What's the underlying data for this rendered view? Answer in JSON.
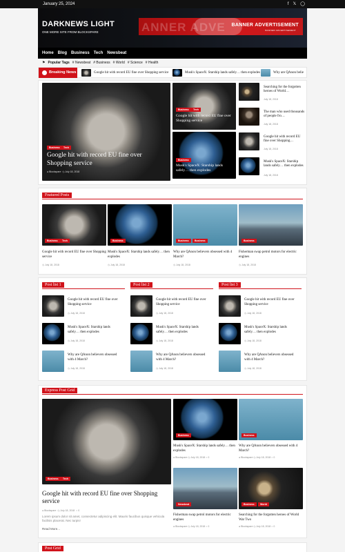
{
  "date": "January 25, 2024",
  "header": {
    "title": "DARKNEWS LIGHT",
    "tagline": "ONE MORE SITE FROM BLOCKSPARE",
    "banner_ghost": "ANNER ADVE",
    "banner_title": "BANNER ADVERTISEMENT",
    "banner_sub": "BANNER ADVERTISEMENT"
  },
  "social": [
    "f-icon",
    "twitter-icon",
    "instagram-icon"
  ],
  "nav": [
    "Home",
    "Blog",
    "Business",
    "Tech",
    "Newsbeat"
  ],
  "popular": {
    "label": "Popular Tags",
    "tags": [
      "Newsbeat",
      "Business",
      "World",
      "Science",
      "Health"
    ]
  },
  "breaking": {
    "label": "Breaking News",
    "items": [
      "Google hit with record EU fine over Shopping service",
      "Musk's SpaceX: Starship lands safely… then explodes",
      "Why are QAnon belie"
    ]
  },
  "hero": {
    "title": "Google hit with record EU fine over Shopping service",
    "badges": [
      "Business",
      "Tech"
    ],
    "author": "Blockspare",
    "date": "July 18, 2018"
  },
  "side_cards": [
    {
      "badges": [
        "Business",
        "Tech"
      ],
      "title": "Google hit with record EU fine over Shopping service"
    },
    {
      "badges": [
        "Business"
      ],
      "title": "Musk's SpaceX: Starship lands safely… then explodes"
    }
  ],
  "side_list": [
    {
      "title": "Searching for the forgotten heroes of World…",
      "date": "July 18, 2018"
    },
    {
      "title": "The man who used thousands of people fro…",
      "date": "July 18, 2018"
    },
    {
      "title": "Google hit with record EU fine over Shopping…",
      "date": "July 18, 2018"
    },
    {
      "title": "Musk's SpaceX: Starship lands safely… then explodes",
      "date": "July 18, 2018"
    }
  ],
  "featured": {
    "title": "Featured Posts",
    "items": [
      {
        "badges": [
          "Business",
          "Tech"
        ],
        "title": "Google hit with record EU fine over Shopping service",
        "date": "July 18, 2018"
      },
      {
        "badges": [
          "Business"
        ],
        "title": "Musk's SpaceX: Starship lands safely… then explodes",
        "date": "July 18, 2018"
      },
      {
        "badges": [
          "Business",
          "Business"
        ],
        "title": "Why are QAnon believers obsessed with 4 March?",
        "date": "July 18, 2018"
      },
      {
        "badges": [
          "Business"
        ],
        "title": "Fisherman swap petrol motors for electric engines",
        "date": "July 18, 2018"
      }
    ]
  },
  "postlists": [
    {
      "title": "Post list 1"
    },
    {
      "title": "Post list 2"
    },
    {
      "title": "Post list 3"
    }
  ],
  "postlist_items": [
    {
      "title": "Google hit with record EU fine over Shopping service",
      "date": "July 18, 2018"
    },
    {
      "title": "Musk's SpaceX: Starship lands safely… then explodes",
      "date": "July 18, 2018"
    },
    {
      "title": "Why are QAnon believers obsessed with 4 March?",
      "date": "July 18, 2018"
    }
  ],
  "express": {
    "title": "Express Post Grid",
    "main": {
      "badges": [
        "Business",
        "Tech"
      ],
      "title": "Google hit with record EU fine over Shopping service",
      "author": "Blockspare",
      "date": "July 18, 2018",
      "comments": "0",
      "excerpt": "Lorem ipsum dolor sit amet, consectetur adipiscing elit. Mauris faucibus quisque vehicula facilisis placerat. Nec turpis!",
      "read_more": "Read More..."
    },
    "grid": [
      {
        "badges": [
          "Business"
        ],
        "title": "Musk's SpaceX: Starship lands safely… then explodes",
        "author": "Blockspare",
        "date": "July 18, 2018",
        "comments": "0"
      },
      {
        "badges": [
          "Business"
        ],
        "title": "Why are QAnon believers obsessed with 4 March?",
        "author": "Blockspare",
        "date": "July 18, 2018",
        "comments": "0"
      },
      {
        "badges": [
          "Newsbeat"
        ],
        "title": "Fisherman swap petrol motors for electric engines",
        "author": "Blockspare",
        "date": "July 18, 2018",
        "comments": "0"
      },
      {
        "badges": [
          "Business",
          "World"
        ],
        "title": "Searching for the forgotten heroes of World War Two",
        "author": "Blockspare",
        "date": "July 18, 2018",
        "comments": "0"
      }
    ]
  },
  "postgrid": {
    "title": "Post Grid"
  }
}
